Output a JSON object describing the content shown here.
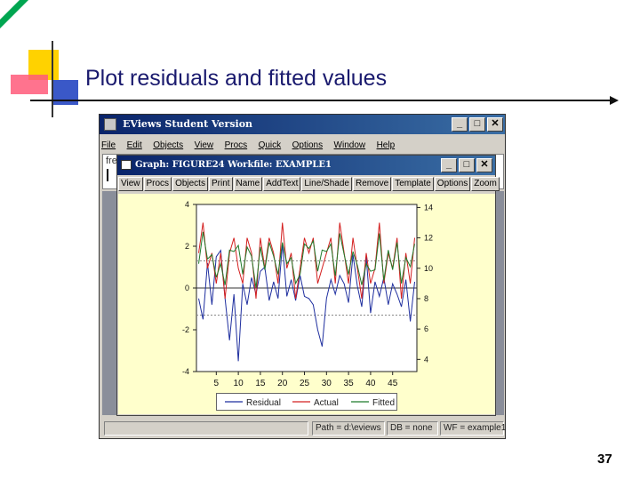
{
  "slide": {
    "title": "Plot residuals and fitted values",
    "page_number": "37"
  },
  "app_window": {
    "title": "EViews Student Version",
    "menu": [
      "File",
      "Edit",
      "Objects",
      "View",
      "Procs",
      "Quick",
      "Options",
      "Window",
      "Help"
    ],
    "command_text": "fre",
    "buttons": {
      "minimize": "_",
      "maximize": "□",
      "close": "✕"
    },
    "status": {
      "path": "Path = d:\\eviews",
      "db": "DB = none",
      "wf": "WF = example1"
    }
  },
  "graph_window": {
    "title": "Graph: FIGURE24    Workfile: EXAMPLE1",
    "toolbar": [
      "View",
      "Procs",
      "Objects",
      "Print",
      "Name",
      "AddText",
      "Line/Shade",
      "Remove",
      "Template",
      "Options",
      "Zoom"
    ]
  },
  "chart_data": {
    "type": "line",
    "x": [
      1,
      2,
      3,
      4,
      5,
      6,
      7,
      8,
      9,
      10,
      11,
      12,
      13,
      14,
      15,
      16,
      17,
      18,
      19,
      20,
      21,
      22,
      23,
      24,
      25,
      26,
      27,
      28,
      29,
      30,
      31,
      32,
      33,
      34,
      35,
      36,
      37,
      38,
      39,
      40,
      41,
      42,
      43,
      44,
      45,
      46,
      47,
      48,
      49,
      50
    ],
    "x_ticks": [
      "5",
      "10",
      "15",
      "20",
      "25",
      "30",
      "35",
      "40",
      "45"
    ],
    "x_tick_values": [
      5,
      10,
      15,
      20,
      25,
      30,
      35,
      40,
      45
    ],
    "left_axis": {
      "ticks": [
        "4",
        "2",
        "0",
        "-2",
        "-4"
      ],
      "tick_values": [
        4,
        2,
        0,
        -2,
        -4
      ],
      "range": [
        -4,
        4
      ],
      "series": [
        "Residual"
      ]
    },
    "right_axis": {
      "ticks": [
        "14",
        "12",
        "10",
        "8",
        "6",
        "4"
      ],
      "tick_values": [
        14,
        12,
        10,
        8,
        6,
        4
      ],
      "range": [
        3.2,
        14.2
      ],
      "series": [
        "Actual",
        "Fitted"
      ]
    },
    "reference_lines_left": [
      0,
      1.3,
      -1.3
    ],
    "series": [
      {
        "name": "Residual",
        "color": "#1f2f9f",
        "axis": "left",
        "values": [
          -0.5,
          -1.5,
          1.2,
          -0.8,
          1.5,
          1.8,
          -0.5,
          -2.5,
          -0.3,
          -3.5,
          0.2,
          -0.8,
          0.5,
          -0.3,
          0.8,
          1.0,
          -0.6,
          0.3,
          -0.5,
          2.1,
          -0.4,
          0.4,
          -0.6,
          0.6,
          -0.4,
          -0.5,
          -0.8,
          -2.0,
          -2.8,
          -0.5,
          0.4,
          -0.3,
          0.6,
          0.2,
          -0.7,
          1.6,
          0.1,
          -0.9,
          1.5,
          -1.2,
          0.3,
          -0.4,
          0.5,
          -0.8,
          0.2,
          -0.3,
          -0.9,
          0.4,
          -1.6,
          0.3
        ]
      },
      {
        "name": "Actual",
        "color": "#d42020",
        "axis": "right",
        "values": [
          11,
          13,
          10,
          11,
          9,
          11,
          8,
          11,
          12,
          10,
          9,
          12,
          11,
          8,
          12,
          10,
          12,
          11,
          9,
          13,
          10,
          11,
          8,
          10,
          12,
          11,
          12,
          9,
          10,
          11,
          12,
          9,
          13,
          11,
          9,
          12,
          10,
          8,
          11,
          9,
          10,
          13,
          9,
          11,
          10,
          12,
          8,
          11,
          9,
          12
        ]
      },
      {
        "name": "Fitted",
        "color": "#1f7a2a",
        "axis": "right",
        "values": [
          10.3,
          12.4,
          10.6,
          10.9,
          9.4,
          10.3,
          8.9,
          11.2,
          11.1,
          11.5,
          9.6,
          11.4,
          10.8,
          8.7,
          11.4,
          9.9,
          11.7,
          10.8,
          9.6,
          11.7,
          10.3,
          10.7,
          9.0,
          9.6,
          11.6,
          11.3,
          11.8,
          9.8,
          11.2,
          11.1,
          11.6,
          9.5,
          12.3,
          10.9,
          9.6,
          11.1,
          10.2,
          8.9,
          10.3,
          9.8,
          9.9,
          12.3,
          9.2,
          11.2,
          9.9,
          11.7,
          9.0,
          10.7,
          10.1,
          11.6
        ]
      }
    ],
    "legend": [
      "Residual",
      "Actual",
      "Fitted"
    ],
    "legend_position": "bottom"
  }
}
